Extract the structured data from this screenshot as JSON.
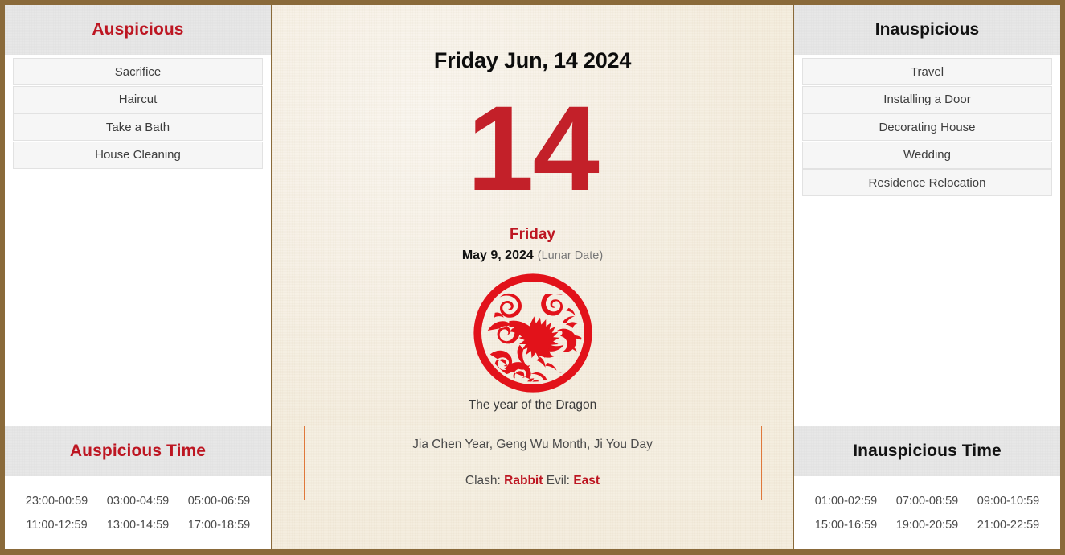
{
  "frame": {
    "border_color": "#8a6a3a",
    "paper_color": "#f4ecdd",
    "accent_red": "#bd1622",
    "accent_orange": "#e0783a"
  },
  "left_panel": {
    "header": "Auspicious",
    "items": [
      {
        "label": "Sacrifice"
      },
      {
        "label": "Haircut"
      },
      {
        "label": "Take a Bath"
      },
      {
        "label": "House Cleaning"
      }
    ],
    "time_header": "Auspicious Time",
    "times": [
      "23:00-00:59",
      "03:00-04:59",
      "05:00-06:59",
      "11:00-12:59",
      "13:00-14:59",
      "17:00-18:59"
    ]
  },
  "right_panel": {
    "header": "Inauspicious",
    "items": [
      {
        "label": "Travel"
      },
      {
        "label": "Installing a Door"
      },
      {
        "label": "Decorating House"
      },
      {
        "label": "Wedding"
      },
      {
        "label": "Residence Relocation"
      }
    ],
    "time_header": "Inauspicious Time",
    "times": [
      "01:00-02:59",
      "07:00-08:59",
      "09:00-10:59",
      "15:00-16:59",
      "19:00-20:59",
      "21:00-22:59"
    ]
  },
  "center": {
    "date_title": "Friday Jun, 14 2024",
    "day_number": "14",
    "weekday": "Friday",
    "lunar_date": "May 9, 2024",
    "lunar_note": "(Lunar Date)",
    "zodiac_icon": "dragon-papercut-icon",
    "zodiac_label": "The year of the Dragon",
    "ganzhi": "Jia Chen Year, Geng Wu Month, Ji You Day",
    "clash_label": "Clash:",
    "clash_value": "Rabbit",
    "evil_label": "Evil:",
    "evil_value": "East"
  }
}
